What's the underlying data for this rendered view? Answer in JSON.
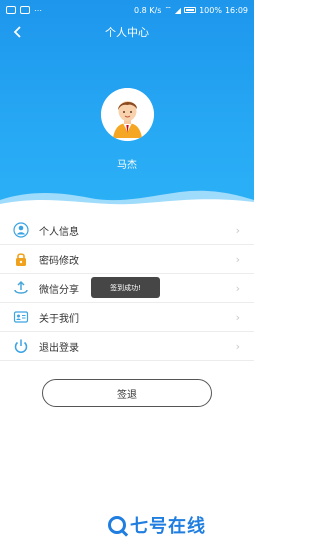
{
  "status_bar": {
    "speed": "0.8 K/s",
    "battery_percent": "100%",
    "time": "16:09"
  },
  "nav": {
    "back_icon": "chevron-left-icon",
    "title": "个人中心"
  },
  "profile": {
    "name": "马杰",
    "avatar_icon": "male-avatar-icon"
  },
  "menu": {
    "items": [
      {
        "label": "个人信息",
        "icon": "person-icon",
        "color": "#3aa3e3"
      },
      {
        "label": "密码修改",
        "icon": "lock-icon",
        "color": "#f0a21e"
      },
      {
        "label": "微信分享",
        "icon": "share-icon",
        "color": "#4aa6d8"
      },
      {
        "label": "关于我们",
        "icon": "id-card-icon",
        "color": "#3aa3e3"
      },
      {
        "label": "退出登录",
        "icon": "power-icon",
        "color": "#3aa3e3"
      }
    ]
  },
  "toast": {
    "text": "签到成功!"
  },
  "sign_out_button": {
    "label": "签退"
  },
  "watermark": {
    "text": "七号在线"
  },
  "colors": {
    "header_blue": "#1d96ec",
    "accent": "#1f7ee0"
  }
}
